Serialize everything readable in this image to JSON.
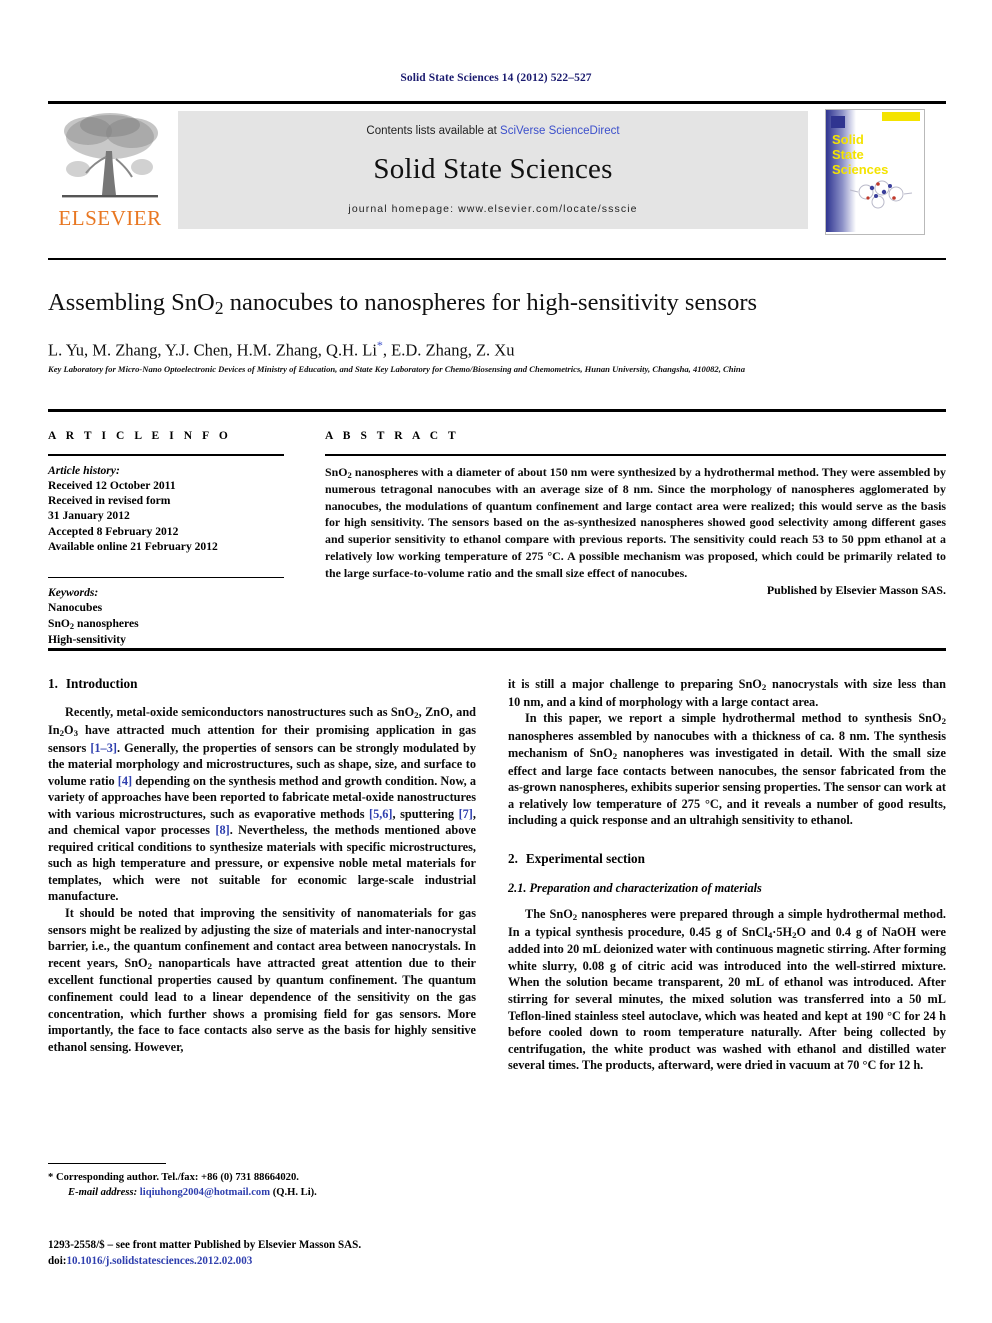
{
  "running_head": "Solid State Sciences 14 (2012) 522–527",
  "masthead": {
    "contents_prefix": "Contents lists available at ",
    "contents_link": "SciVerse ScienceDirect",
    "journal_title": "Solid State Sciences",
    "homepage": "journal homepage: www.elsevier.com/locate/ssscie",
    "publisher_logo_text": "ELSEVIER",
    "cover_title_lines": [
      "Solid",
      "State",
      "Sciences"
    ],
    "accent_orange": "#e87722",
    "link_blue": "#3b4fcb",
    "panel_gray": "#e4e4e4",
    "cover_blue": "#3b3f96",
    "cover_yellow": "#f4e300"
  },
  "article": {
    "title_part1": "Assembling SnO",
    "title_sub": "2",
    "title_part2": " nanocubes to nanospheres for high-sensitivity sensors",
    "authors": "L. Yu, M. Zhang, Y.J. Chen, H.M. Zhang, Q.H. Li",
    "authors_tail": ", E.D. Zhang, Z. Xu",
    "corresponding_marker": "*",
    "affiliation": "Key Laboratory for Micro-Nano Optoelectronic Devices of Ministry of Education, and State Key Laboratory for Chemo/Biosensing and Chemometrics, Hunan University, Changsha, 410082, China"
  },
  "article_info": {
    "heading": "A R T I C L E   I N F O",
    "history_label": "Article history:",
    "history": [
      "Received 12 October 2011",
      "Received in revised form",
      "31 January 2012",
      "Accepted 8 February 2012",
      "Available online 21 February 2012"
    ],
    "keywords_label": "Keywords:",
    "keywords": [
      "Nanocubes",
      "SnO2 nanospheres",
      "High-sensitivity"
    ]
  },
  "abstract": {
    "heading": "A B S T R A C T",
    "text": "SnO2 nanospheres with a diameter of about 150 nm were synthesized by a hydrothermal method. They were assembled by numerous tetragonal nanocubes with an average size of 8 nm. Since the morphology of nanospheres agglomerated by nanocubes, the modulations of quantum confinement and large contact area were realized; this would serve as the basis for high sensitivity. The sensors based on the as-synthesized nanospheres showed good selectivity among different gases and superior sensitivity to ethanol compare with previous reports. The sensitivity could reach 53 to 50 ppm ethanol at a relatively low working temperature of 275 °C. A possible mechanism was proposed, which could be primarily related to the large surface-to-volume ratio and the small size effect of nanocubes.",
    "publisher_line": "Published by Elsevier Masson SAS."
  },
  "body": {
    "intro_heading_num": "1.",
    "intro_heading": "Introduction",
    "intro_p1": "Recently, metal-oxide semiconductors nanostructures such as SnO2, ZnO, and In2O3 have attracted much attention for their promising application in gas sensors [1–3]. Generally, the properties of sensors can be strongly modulated by the material morphology and microstructures, such as shape, size, and surface to volume ratio [4] depending on the synthesis method and growth condition. Now, a variety of approaches have been reported to fabricate metal-oxide nanostructures with various microstructures, such as evaporative methods [5,6], sputtering [7], and chemical vapor processes [8]. Nevertheless, the methods mentioned above required critical conditions to synthesize materials with specific microstructures, such as high temperature and pressure, or expensive noble metal materials for templates, which were not suitable for economic large-scale industrial manufacture.",
    "intro_p2": "It should be noted that improving the sensitivity of nanomaterials for gas sensors might be realized by adjusting the size of materials and inter-nanocrystal barrier, i.e., the quantum confinement and contact area between nanocrystals. In recent years, SnO2 nanoparticals have attracted great attention due to their excellent functional properties caused by quantum confinement. The quantum confinement could lead to a linear dependence of the sensitivity on the gas concentration, which further shows a promising field for gas sensors. More importantly, the face to face contacts also serve as the basis for highly sensitive ethanol sensing. However,",
    "intro_p3": "it is still a major challenge to preparing SnO2 nanocrystals with size less than 10 nm, and a kind of morphology with a large contact area.",
    "intro_p4": "In this paper, we report a simple hydrothermal method to synthesis SnO2 nanospheres assembled by nanocubes with a thickness of ca. 8 nm. The synthesis mechanism of SnO2 nanopheres was investigated in detail. With the small size effect and large face contacts between nanocubes, the sensor fabricated from the as-grown nanospheres, exhibits superior sensing properties. The sensor can work at a relatively low temperature of 275 °C, and it reveals a number of good results, including a quick response and an ultrahigh sensitivity to ethanol.",
    "exp_heading_num": "2.",
    "exp_heading": "Experimental section",
    "exp_sub": "2.1.  Preparation and characterization of materials",
    "exp_p1": "The SnO2 nanospheres were prepared through a simple hydrothermal method. In a typical synthesis procedure, 0.45 g of SnCl4·5H2O and 0.4 g of NaOH were added into 20 mL deionized water with continuous magnetic stirring. After forming white slurry, 0.08 g of citric acid was introduced into the well-stirred mixture. When the solution became transparent, 20 mL of ethanol was introduced. After stirring for several minutes, the mixed solution was transferred into a 50 mL Teflon-lined stainless steel autoclave, which was heated and kept at 190 °C for 24 h before cooled down to room temperature naturally. After being collected by centrifugation, the white product was washed with ethanol and distilled water several times. The products, afterward, were dried in vacuum at 70 °C for 12 h."
  },
  "footnote": {
    "corresponding": "* Corresponding author. Tel./fax: +86 (0) 731 88664020.",
    "email_label": "E-mail address:",
    "email": " liqiuhong2004@hotmail.com",
    "email_tail": " (Q.H. Li)."
  },
  "footer": {
    "issn_line": "1293-2558/$ – see front matter Published by Elsevier Masson SAS.",
    "doi_prefix": "doi:",
    "doi": "10.1016/j.solidstatesciences.2012.02.003"
  }
}
